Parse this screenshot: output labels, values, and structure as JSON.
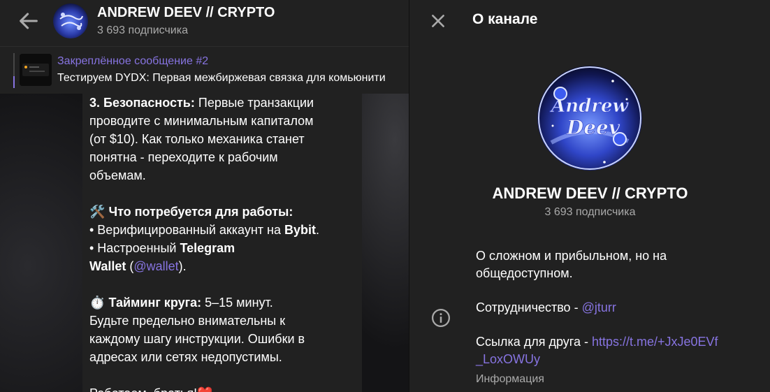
{
  "header": {
    "title": "ANDREW DEEV // CRYPTO",
    "subscribers": "3 693 подписчика"
  },
  "pinned": {
    "title": "Закреплённое сообщение #2",
    "text": "Тестируем DYDX: Первая межбиржевая связка для комьюнити"
  },
  "message": {
    "l1_bold": "3. Безопасность:",
    "l1_rest": " Первые транзакции",
    "l2": "проводите с минимальным капиталом",
    "l3": "(от $10). Как только механика станет",
    "l4": "понятна - переходите к рабочим",
    "l5": "объемам.",
    "tools_emoji": "🛠️",
    "tools_heading": "Что потребуется для работы:",
    "b1_pre": "• Верифицированный аккаунт на ",
    "b1_bold": "Bybit",
    "b1_post": ".",
    "b2_pre": "• Настроенный ",
    "b2_bold": "Telegram",
    "b3_bold": "Wallet",
    "b3_paren_open": " (",
    "b3_link": "@wallet",
    "b3_paren_close": ").",
    "timer_emoji": "⏱️",
    "timer_bold": "Тайминг круга:",
    "timer_rest": " 5–15 минут.",
    "t2": "Будьте предельно внимательны к",
    "t3": "каждому шагу инструкции. Ошибки в",
    "t4": "адресах или сетях недопустимы.",
    "closing": "Работаем, братья!",
    "heart": "❤️"
  },
  "panel": {
    "title": "О канале",
    "name": "ANDREW DEEV // CRYPTO",
    "subscribers": "3 693 подписчика",
    "desc1": "О сложном и прибыльном, но на",
    "desc2": "общедоступном.",
    "collab_label": "Сотрудничество - ",
    "collab_link": "@jturr",
    "friend_label": "Ссылка для друга - ",
    "friend_link1": "https://t.me/+JxJe0EVf",
    "friend_link2": "_LoxOWUy",
    "info_label": "Информация",
    "avatar_text1": "Andrew",
    "avatar_text2": "Deev"
  },
  "colors": {
    "accent": "#8774e1",
    "panel_bg": "#212121",
    "muted": "#aaaaaa"
  },
  "icons": [
    "back-arrow-icon",
    "close-icon",
    "info-icon"
  ]
}
